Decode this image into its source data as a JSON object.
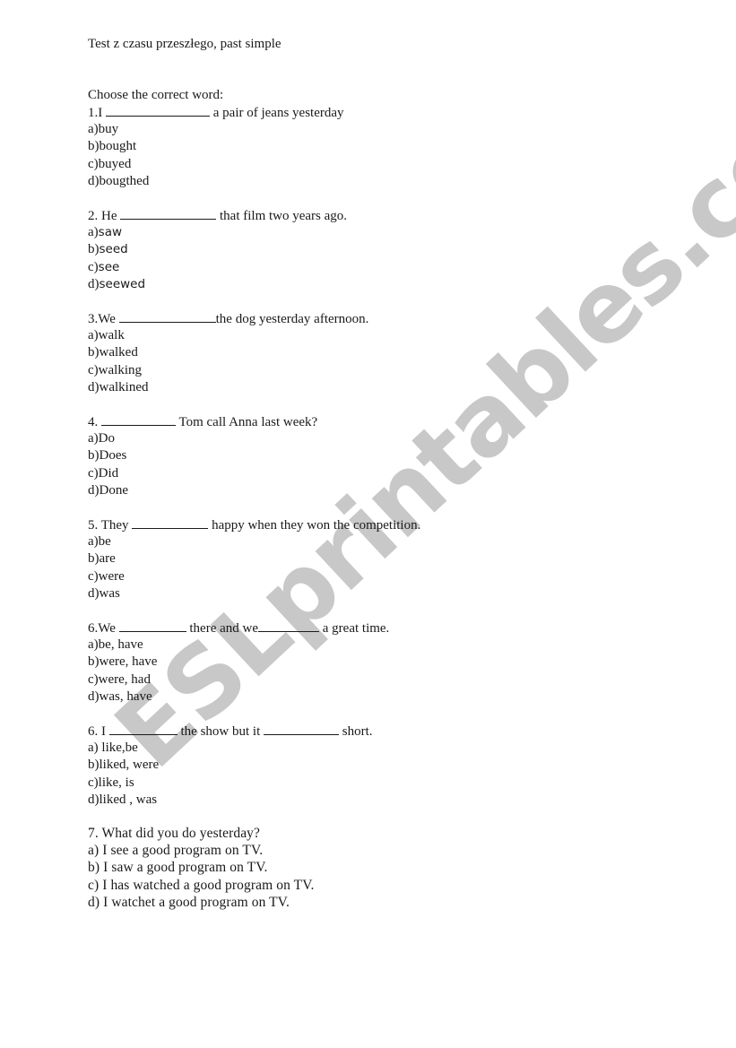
{
  "document": {
    "title": "Test z czasu przeszłego, past simple",
    "instruction": "Choose the correct word:",
    "watermark": "ESLprintables.com"
  },
  "questions": [
    {
      "number_label": "1.I",
      "stem_parts": [
        "a pair of jeans yesterday"
      ],
      "options": [
        {
          "letter": "a)",
          "text": "buy"
        },
        {
          "letter": "b)",
          "text": "bought"
        },
        {
          "letter": "c)",
          "text": "buyed"
        },
        {
          "letter": "d)",
          "text": "bougthed"
        }
      ]
    },
    {
      "number_label": "2. He",
      "stem_parts": [
        "that film two years ago."
      ],
      "options": [
        {
          "letter": "a)",
          "text": "saw"
        },
        {
          "letter": "b)",
          "text": "seed"
        },
        {
          "letter": "c)",
          "text": "see"
        },
        {
          "letter": "d)",
          "text": "seewed"
        }
      ]
    },
    {
      "number_label": "3.We",
      "stem_parts": [
        "the dog yesterday afternoon."
      ],
      "options": [
        {
          "letter": "a)",
          "text": "walk"
        },
        {
          "letter": "b)",
          "text": "walked"
        },
        {
          "letter": "c)",
          "text": "walking"
        },
        {
          "letter": "d)",
          "text": "walkined"
        }
      ]
    },
    {
      "number_label": "4.",
      "stem_parts": [
        "Tom call Anna last week?"
      ],
      "options": [
        {
          "letter": "a)",
          "text": "Do"
        },
        {
          "letter": "b)",
          "text": "Does"
        },
        {
          "letter": "c)",
          "text": "Did"
        },
        {
          "letter": "d)",
          "text": "Done"
        }
      ]
    },
    {
      "number_label": "5. They",
      "stem_parts": [
        "happy when they won the competition."
      ],
      "options": [
        {
          "letter": "a)",
          "text": "be"
        },
        {
          "letter": "b)",
          "text": "are"
        },
        {
          "letter": "c)",
          "text": "were"
        },
        {
          "letter": "d)",
          "text": "was"
        }
      ]
    },
    {
      "number_label": "6.We",
      "stem_parts": [
        "there and we",
        "a great time."
      ],
      "options": [
        {
          "letter": "a)",
          "text": "be, have"
        },
        {
          "letter": "b)",
          "text": "were, have"
        },
        {
          "letter": "c)",
          "text": "were, had"
        },
        {
          "letter": "d)",
          "text": "was, have"
        }
      ]
    },
    {
      "number_label": "6. I",
      "stem_parts": [
        "the show but it",
        "short."
      ],
      "options": [
        {
          "letter": "a)",
          "text": " like,be"
        },
        {
          "letter": "b)",
          "text": "liked, were"
        },
        {
          "letter": "c)",
          "text": "like, is"
        },
        {
          "letter": "d)",
          "text": "liked , was"
        }
      ]
    },
    {
      "number_label": "7. What did you do yesterday?",
      "stem_parts": [],
      "options": [
        {
          "letter": "a)",
          "text": " I see a good program on TV."
        },
        {
          "letter": "b)",
          "text": " I saw a good program on TV."
        },
        {
          "letter": "c)",
          "text": " I has watched a good program on TV."
        },
        {
          "letter": "d)",
          "text": " I watchet a good program on TV."
        }
      ]
    }
  ]
}
